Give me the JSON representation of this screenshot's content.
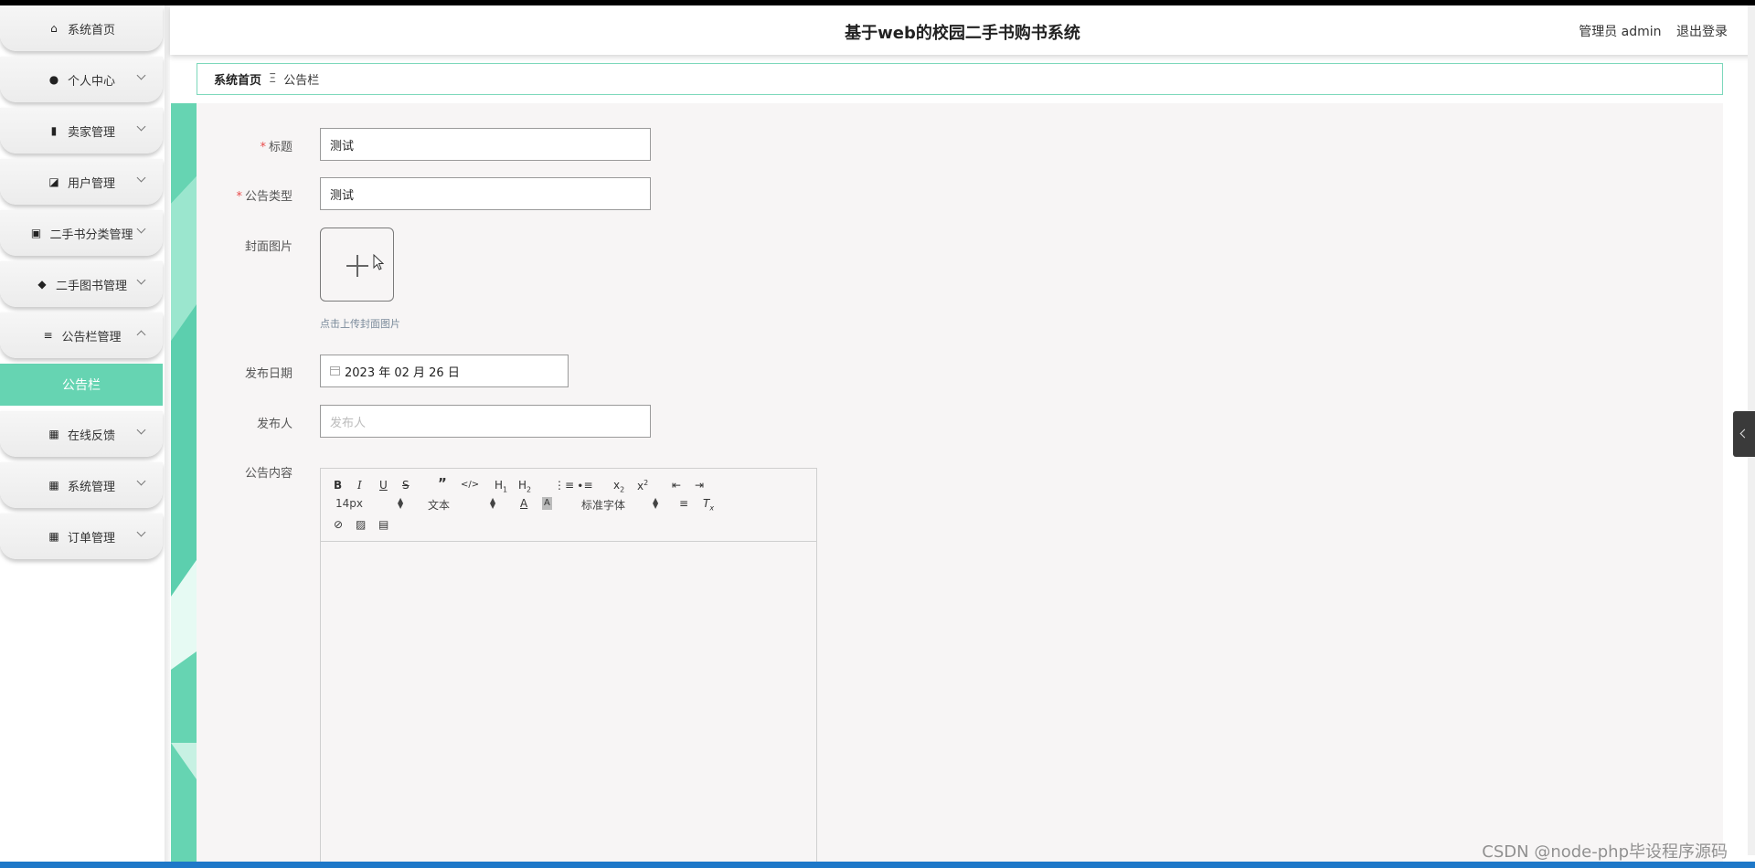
{
  "app": {
    "title": "基于web的校园二手书购书系统",
    "user_label": "管理员 admin",
    "logout_label": "退出登录"
  },
  "sidebar": {
    "items": [
      {
        "label": "系统首页",
        "icon": "home-icon",
        "glyph": "⌂",
        "caret": false
      },
      {
        "label": "个人中心",
        "icon": "person-icon",
        "glyph": "●",
        "caret": true
      },
      {
        "label": "卖家管理",
        "icon": "bar-chart-icon",
        "glyph": "▮",
        "caret": true
      },
      {
        "label": "用户管理",
        "icon": "trend-chart-icon",
        "glyph": "◪",
        "caret": true
      },
      {
        "label": "二手书分类管理",
        "icon": "clipboard-icon",
        "glyph": "▣",
        "caret": true
      },
      {
        "label": "二手图书管理",
        "icon": "location-pin-icon",
        "glyph": "◆",
        "caret": true
      },
      {
        "label": "公告栏管理",
        "icon": "sliders-icon",
        "glyph": "≡",
        "caret": true,
        "expanded": true
      },
      {
        "label": "在线反馈",
        "icon": "grid-icon",
        "glyph": "▦",
        "caret": true
      },
      {
        "label": "系统管理",
        "icon": "grid-icon",
        "glyph": "▦",
        "caret": true
      },
      {
        "label": "订单管理",
        "icon": "grid-icon",
        "glyph": "▦",
        "caret": true
      }
    ],
    "active_subitem": "公告栏"
  },
  "breadcrumb": {
    "home": "系统首页",
    "separator": "Ξ",
    "current": "公告栏"
  },
  "form": {
    "title": {
      "label": "标题",
      "required": true,
      "value": "测试"
    },
    "type": {
      "label": "公告类型",
      "required": true,
      "value": "测试"
    },
    "cover": {
      "label": "封面图片",
      "hint": "点击上传封面图片"
    },
    "date": {
      "label": "发布日期",
      "value": "2023 年 02 月 26 日"
    },
    "publisher": {
      "label": "发布人",
      "placeholder": "发布人"
    },
    "content": {
      "label": "公告内容"
    }
  },
  "editor": {
    "font_size": "14px",
    "text_style": "文本",
    "font_family": "标准字体"
  },
  "watermark": "CSDN @node-php毕设程序源码",
  "colors": {
    "accent": "#66d4b2",
    "required": "#e94b4b"
  }
}
